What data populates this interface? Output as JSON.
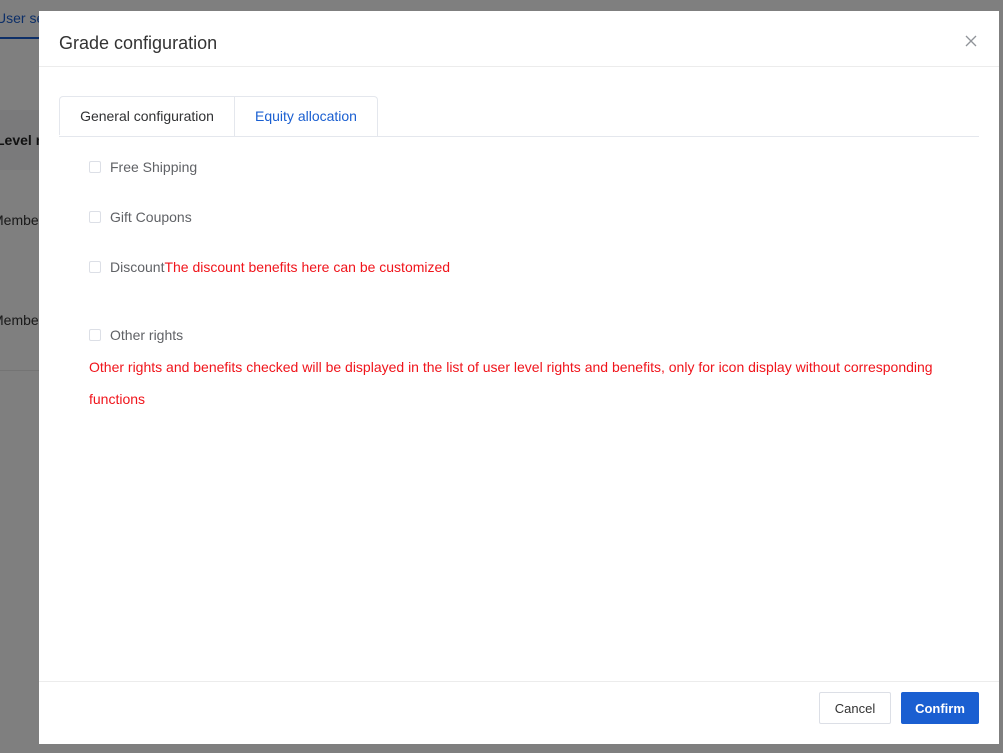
{
  "background": {
    "tab_label": "User settings",
    "column_header": "Level name",
    "rows": [
      "Member",
      "Member"
    ]
  },
  "dialog": {
    "title": "Grade configuration",
    "tabs": [
      {
        "label": "General configuration",
        "active": false
      },
      {
        "label": "Equity allocation",
        "active": true
      }
    ],
    "options": {
      "free_shipping": {
        "label": "Free Shipping",
        "checked": false
      },
      "gift_coupons": {
        "label": "Gift Coupons",
        "checked": false
      },
      "discount": {
        "label": "Discount",
        "checked": false,
        "hint": "The discount benefits here can be customized"
      },
      "other_rights": {
        "label": "Other rights",
        "checked": false
      }
    },
    "other_rights_hint": "Other rights and benefits checked will be displayed in the list of user level rights and benefits, only for icon display without corresponding functions",
    "footer": {
      "cancel_label": "Cancel",
      "confirm_label": "Confirm"
    }
  },
  "colors": {
    "accent": "#1a5fd1",
    "hint_red": "#f0141b",
    "mask": "rgba(0,0,0,0.5)"
  },
  "icons": {
    "close": "close-icon"
  }
}
